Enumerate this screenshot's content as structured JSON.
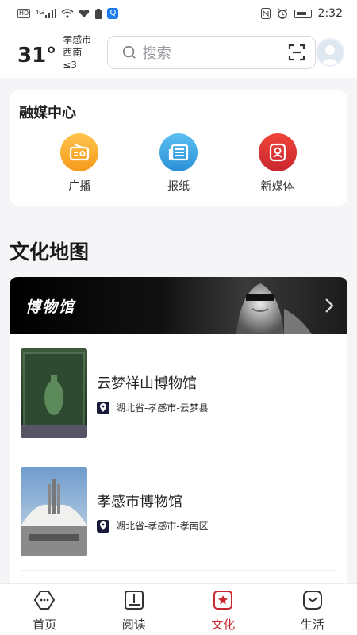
{
  "status_bar": {
    "hd": "HD",
    "network": "4G",
    "time": "2:32",
    "icons": [
      "hd-icon",
      "signal-icon",
      "wifi-icon",
      "nfc-icon",
      "alarm-icon",
      "battery-icon"
    ]
  },
  "header": {
    "temperature": "31°",
    "city": "孝感市",
    "wind": "西南 ≤3",
    "search_placeholder": "搜索"
  },
  "media_center": {
    "title": "融媒中心",
    "items": [
      {
        "label": "广播",
        "icon": "radio-icon",
        "color": "#fbb03b"
      },
      {
        "label": "报纸",
        "icon": "newspaper-icon",
        "color": "#3aa6e8"
      },
      {
        "label": "新媒体",
        "icon": "new-media-icon",
        "color": "#e03a2f"
      }
    ]
  },
  "culture_map": {
    "title": "文化地图",
    "banner": {
      "label": "博物馆"
    },
    "museums": [
      {
        "name": "云梦祥山博物馆",
        "location": "湖北省-孝感市-云梦县"
      },
      {
        "name": "孝感市博物馆",
        "location": "湖北省-孝感市-孝南区"
      }
    ]
  },
  "tabbar": {
    "tabs": [
      {
        "label": "首页",
        "icon": "home-icon",
        "active": false
      },
      {
        "label": "阅读",
        "icon": "book-icon",
        "active": false
      },
      {
        "label": "文化",
        "icon": "culture-icon",
        "active": true
      },
      {
        "label": "生活",
        "icon": "life-icon",
        "active": false
      }
    ],
    "active_color": "#c8262e"
  }
}
